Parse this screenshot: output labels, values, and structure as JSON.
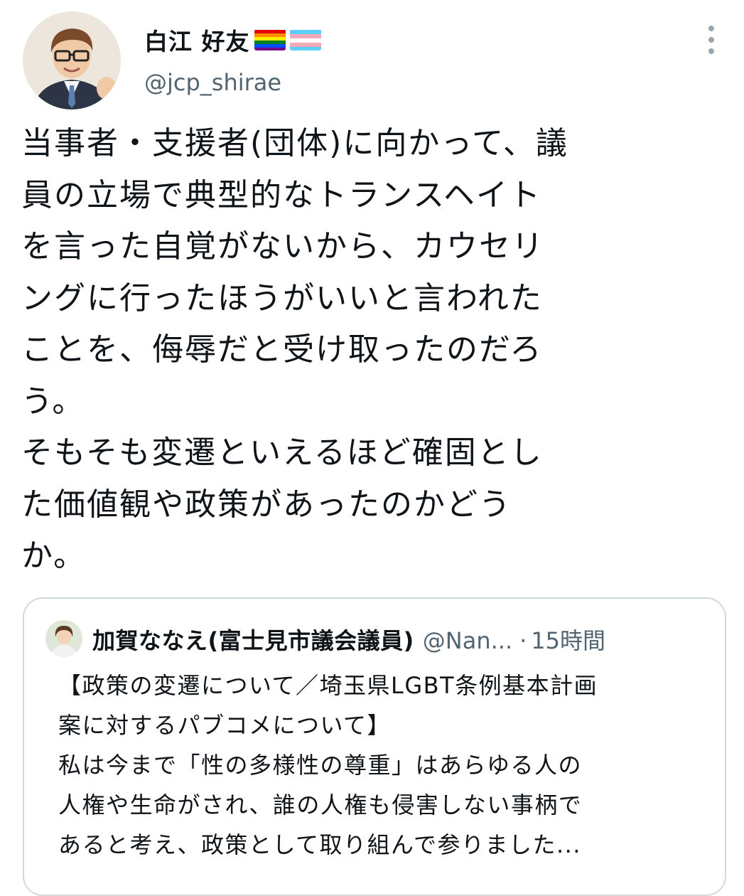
{
  "author": {
    "display_name": "白江 好友",
    "handle": "@jcp_shirae",
    "flag_icons": [
      "rainbow-flag-icon",
      "transgender-flag-icon"
    ]
  },
  "tweet": {
    "text": "当事者・支援者(団体)に向かって、議\n員の立場で典型的なトランスヘイト\nを言った自覚がないから、カウセリ\nングに行ったほうがいいと言われた\nことを、侮辱だと受け取ったのだろ\nう。\nそもそも変遷といえるほど確固とし\nた価値観や政策があったのかどう\nか。"
  },
  "quoted_tweet": {
    "author_name": "加賀ななえ(富士見市議会議員)",
    "handle": "@Nan...",
    "separator": "·",
    "time": "15時間",
    "text": "【政策の変遷について／埼玉県LGBT条例基本計画\n案に対するパブコメについて】\n私は今まで「性の多様性の尊重」はあらゆる人の\n人権や生命がされ、誰の人権も侵害しない事柄で\nあると考え、政策として取り組んで参りました..."
  },
  "colors": {
    "text_primary": "#0f1419",
    "text_secondary": "#536471",
    "border": "#cfd9de",
    "background": "#ffffff"
  }
}
